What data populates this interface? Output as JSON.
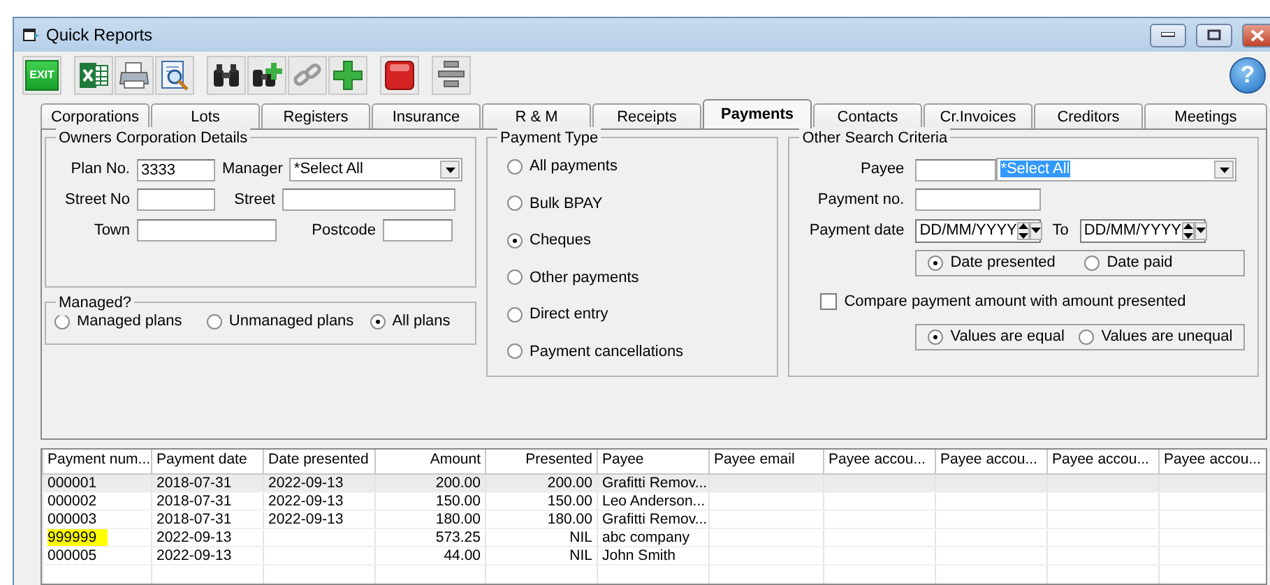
{
  "window": {
    "title": "Quick Reports"
  },
  "toolbar": [
    {
      "kind": "exit",
      "label": "EXIT"
    },
    {
      "kind": "excel"
    },
    {
      "kind": "print"
    },
    {
      "kind": "preview"
    },
    {
      "kind": "find"
    },
    {
      "kind": "find-add"
    },
    {
      "kind": "link"
    },
    {
      "kind": "add"
    },
    {
      "kind": "stop"
    },
    {
      "kind": "align"
    }
  ],
  "help": {
    "label": "?"
  },
  "tabs": [
    {
      "label": "Corporations",
      "selected": false
    },
    {
      "label": "Lots",
      "selected": false
    },
    {
      "label": "Registers",
      "selected": false
    },
    {
      "label": "Insurance",
      "selected": false
    },
    {
      "label": "R & M",
      "selected": false
    },
    {
      "label": "Receipts",
      "selected": false
    },
    {
      "label": "Payments",
      "selected": true
    },
    {
      "label": "Contacts",
      "selected": false
    },
    {
      "label": "Cr.Invoices",
      "selected": false
    },
    {
      "label": "Creditors",
      "selected": false
    },
    {
      "label": "Meetings",
      "selected": false
    }
  ],
  "owners_corporation": {
    "title": "Owners Corporation Details",
    "plan_no": {
      "label": "Plan No.",
      "value": "3333"
    },
    "manager": {
      "label": "Manager",
      "value": "*Select All"
    },
    "street_no": {
      "label": "Street No"
    },
    "street": {
      "label": "Street"
    },
    "town": {
      "label": "Town"
    },
    "postcode": {
      "label": "Postcode"
    }
  },
  "managed": {
    "title": "Managed?",
    "options": [
      {
        "label": "Managed plans",
        "selected": false
      },
      {
        "label": "Unmanaged plans",
        "selected": false
      },
      {
        "label": "All plans",
        "selected": true
      }
    ]
  },
  "payment_type": {
    "title": "Payment Type",
    "options": [
      {
        "label": "All payments",
        "selected": false
      },
      {
        "label": "Bulk BPAY",
        "selected": false
      },
      {
        "label": "Cheques",
        "selected": true
      },
      {
        "label": "Other payments",
        "selected": false
      },
      {
        "label": "Direct entry",
        "selected": false
      },
      {
        "label": "Payment cancellations",
        "selected": false
      }
    ]
  },
  "other_criteria": {
    "title": "Other Search Criteria",
    "payee": {
      "label": "Payee",
      "value": "*Select All",
      "highlighted": true
    },
    "payment_no": {
      "label": "Payment no."
    },
    "payment_date": {
      "label": "Payment date",
      "from": "DD/MM/YYYY",
      "to_label": "To",
      "to": "DD/MM/YYYY"
    },
    "date_basis": [
      {
        "label": "Date presented",
        "selected": true
      },
      {
        "label": "Date paid",
        "selected": false
      }
    ],
    "compare": {
      "label": "Compare payment amount with amount presented",
      "checked": false
    },
    "compare_mode": [
      {
        "label": "Values are equal",
        "selected": true
      },
      {
        "label": "Values are unequal",
        "selected": false
      }
    ]
  },
  "grid": {
    "columns": [
      {
        "label": "Payment num..."
      },
      {
        "label": "Payment date"
      },
      {
        "label": "Date presented"
      },
      {
        "label": "Amount"
      },
      {
        "label": "Presented"
      },
      {
        "label": "Payee"
      },
      {
        "label": "Payee email"
      },
      {
        "label": "Payee accou..."
      },
      {
        "label": "Payee accou..."
      },
      {
        "label": "Payee accou..."
      },
      {
        "label": "Payee accou..."
      }
    ],
    "rows": [
      {
        "cells": [
          "000001",
          "2018-07-31",
          "2022-09-13",
          "200.00",
          "200.00",
          "Grafitti Remov..."
        ],
        "selected": true,
        "highlighted": false
      },
      {
        "cells": [
          "000002",
          "2018-07-31",
          "2022-09-13",
          "150.00",
          "150.00",
          "Leo Anderson..."
        ],
        "selected": false,
        "highlighted": false
      },
      {
        "cells": [
          "000003",
          "2018-07-31",
          "2022-09-13",
          "180.00",
          "180.00",
          "Grafitti Remov..."
        ],
        "selected": false,
        "highlighted": false
      },
      {
        "cells": [
          "999999",
          "2022-09-13",
          null,
          "573.25",
          "NIL",
          "abc company"
        ],
        "selected": false,
        "highlighted": true
      },
      {
        "cells": [
          "000005",
          "2022-09-13",
          null,
          "44.00",
          "NIL",
          "John Smith"
        ],
        "selected": false,
        "highlighted": false
      }
    ]
  }
}
